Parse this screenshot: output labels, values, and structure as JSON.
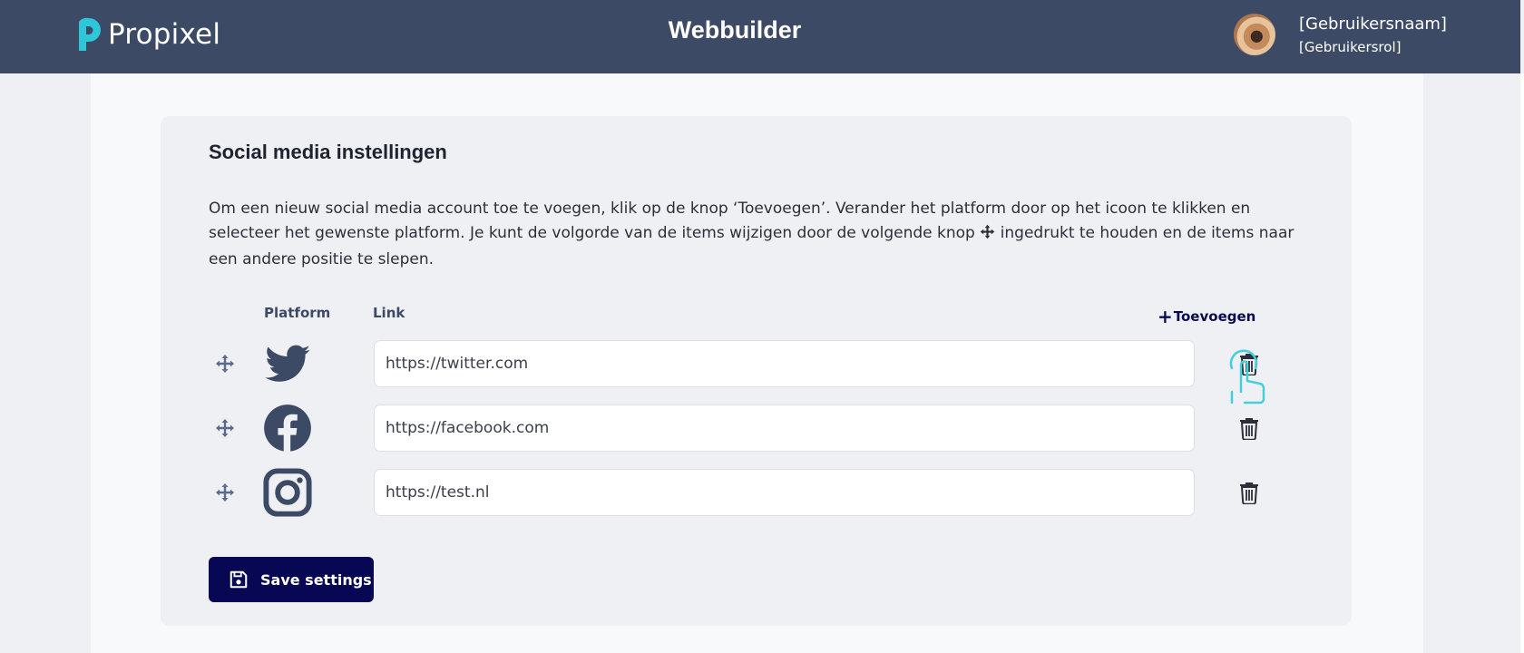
{
  "header": {
    "logo_text": "Propixel",
    "app_title": "Webbuilder",
    "user_name": "[Gebruikersnaam]",
    "user_role": "[Gebruikersrol]"
  },
  "colors": {
    "header_bg": "#3d4a66",
    "logo_accent": "#2ec7d9",
    "primary_button": "#070753",
    "icon_slate": "#3d4a66"
  },
  "section": {
    "title": "Social media instellingen",
    "description_part1": "Om een nieuw social media account toe te voegen, klik op de knop ‘Toevoegen’. Verander het platform door op het icoon te klikken en selecteer het gewenste platform. Je kunt de volgorde van de items wijzigen door de volgende knop",
    "description_part2": "ingedrukt te houden en de items naar een andere positie te slepen.",
    "col_platform": "Platform",
    "col_link": "Link",
    "add_label": "Toevoegen",
    "add_icon": "plus-icon"
  },
  "accounts": [
    {
      "platform": "twitter",
      "icon": "twitter-icon",
      "link": "https://twitter.com"
    },
    {
      "platform": "facebook",
      "icon": "facebook-icon",
      "link": "https://facebook.com"
    },
    {
      "platform": "instagram",
      "icon": "instagram-icon",
      "link": "https://test.nl"
    }
  ],
  "actions": {
    "save_label": "Save settings",
    "save_icon": "floppy-disk-icon"
  }
}
